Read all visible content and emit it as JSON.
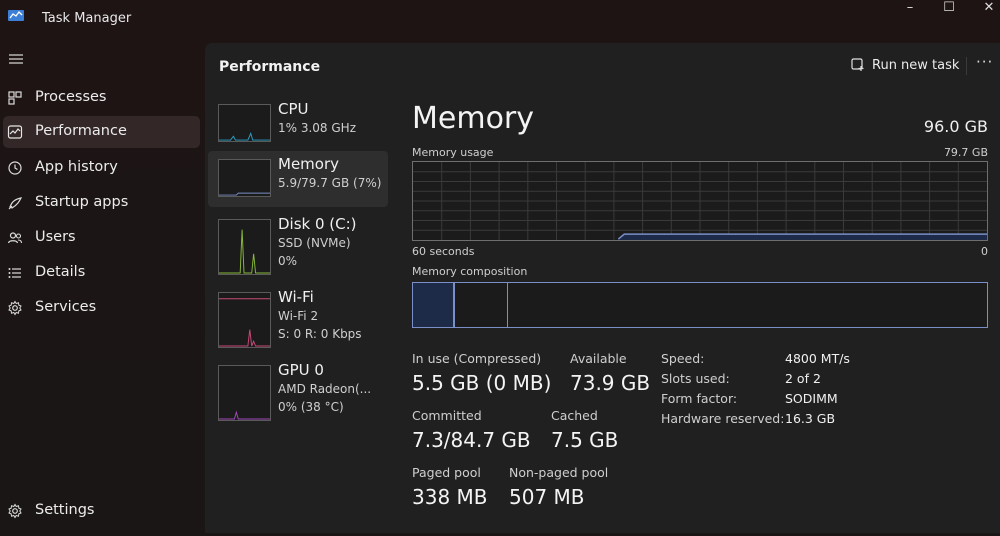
{
  "window": {
    "title": "Task Manager",
    "minimize": "–",
    "maximize": "☐",
    "close": "✕"
  },
  "nav": {
    "items": [
      {
        "label": "Processes",
        "icon": "processes-icon"
      },
      {
        "label": "Performance",
        "icon": "performance-icon",
        "active": true
      },
      {
        "label": "App history",
        "icon": "history-icon"
      },
      {
        "label": "Startup apps",
        "icon": "startup-icon"
      },
      {
        "label": "Users",
        "icon": "users-icon"
      },
      {
        "label": "Details",
        "icon": "details-icon"
      },
      {
        "label": "Services",
        "icon": "services-icon"
      }
    ],
    "settings": "Settings"
  },
  "header": {
    "title": "Performance",
    "run_new_task": "Run new task",
    "more": "···"
  },
  "devices": [
    {
      "name": "CPU",
      "sub1": "1% 3.08 GHz",
      "sub2": "",
      "color": "#2aa0c8"
    },
    {
      "name": "Memory",
      "sub1": "5.9/79.7 GB (7%)",
      "sub2": "",
      "color": "#7a8fc7",
      "active": true
    },
    {
      "name": "Disk 0 (C:)",
      "sub1": "SSD (NVMe)",
      "sub2": "0%",
      "color": "#8ab83a"
    },
    {
      "name": "Wi-Fi",
      "sub1": "Wi-Fi 2",
      "sub2": "S: 0 R: 0 Kbps",
      "color": "#c84a7a"
    },
    {
      "name": "GPU 0",
      "sub1": "AMD Radeon(...",
      "sub2": "0% (38 °C)",
      "color": "#a14ab8"
    }
  ],
  "memory": {
    "title": "Memory",
    "total": "96.0 GB",
    "usage_label": "Memory usage",
    "usage_max": "79.7 GB",
    "time_left": "60 seconds",
    "time_right": "0",
    "composition_label": "Memory composition",
    "in_use_fraction": 0.07,
    "stats": {
      "in_use_label": "In use (Compressed)",
      "in_use_value": "5.5 GB (0 MB)",
      "available_label": "Available",
      "available_value": "73.9 GB",
      "committed_label": "Committed",
      "committed_value": "7.3/84.7 GB",
      "cached_label": "Cached",
      "cached_value": "7.5 GB",
      "paged_label": "Paged pool",
      "paged_value": "338 MB",
      "nonpaged_label": "Non-paged pool",
      "nonpaged_value": "507 MB"
    },
    "specs": [
      {
        "label": "Speed:",
        "value": "4800 MT/s"
      },
      {
        "label": "Slots used:",
        "value": "2 of 2"
      },
      {
        "label": "Form factor:",
        "value": "SODIMM"
      },
      {
        "label": "Hardware reserved:",
        "value": "16.3 GB"
      }
    ]
  },
  "colors": {
    "memory_accent": "#7a8fc7",
    "panel_bg": "#202020",
    "active_nav": "#332727"
  }
}
